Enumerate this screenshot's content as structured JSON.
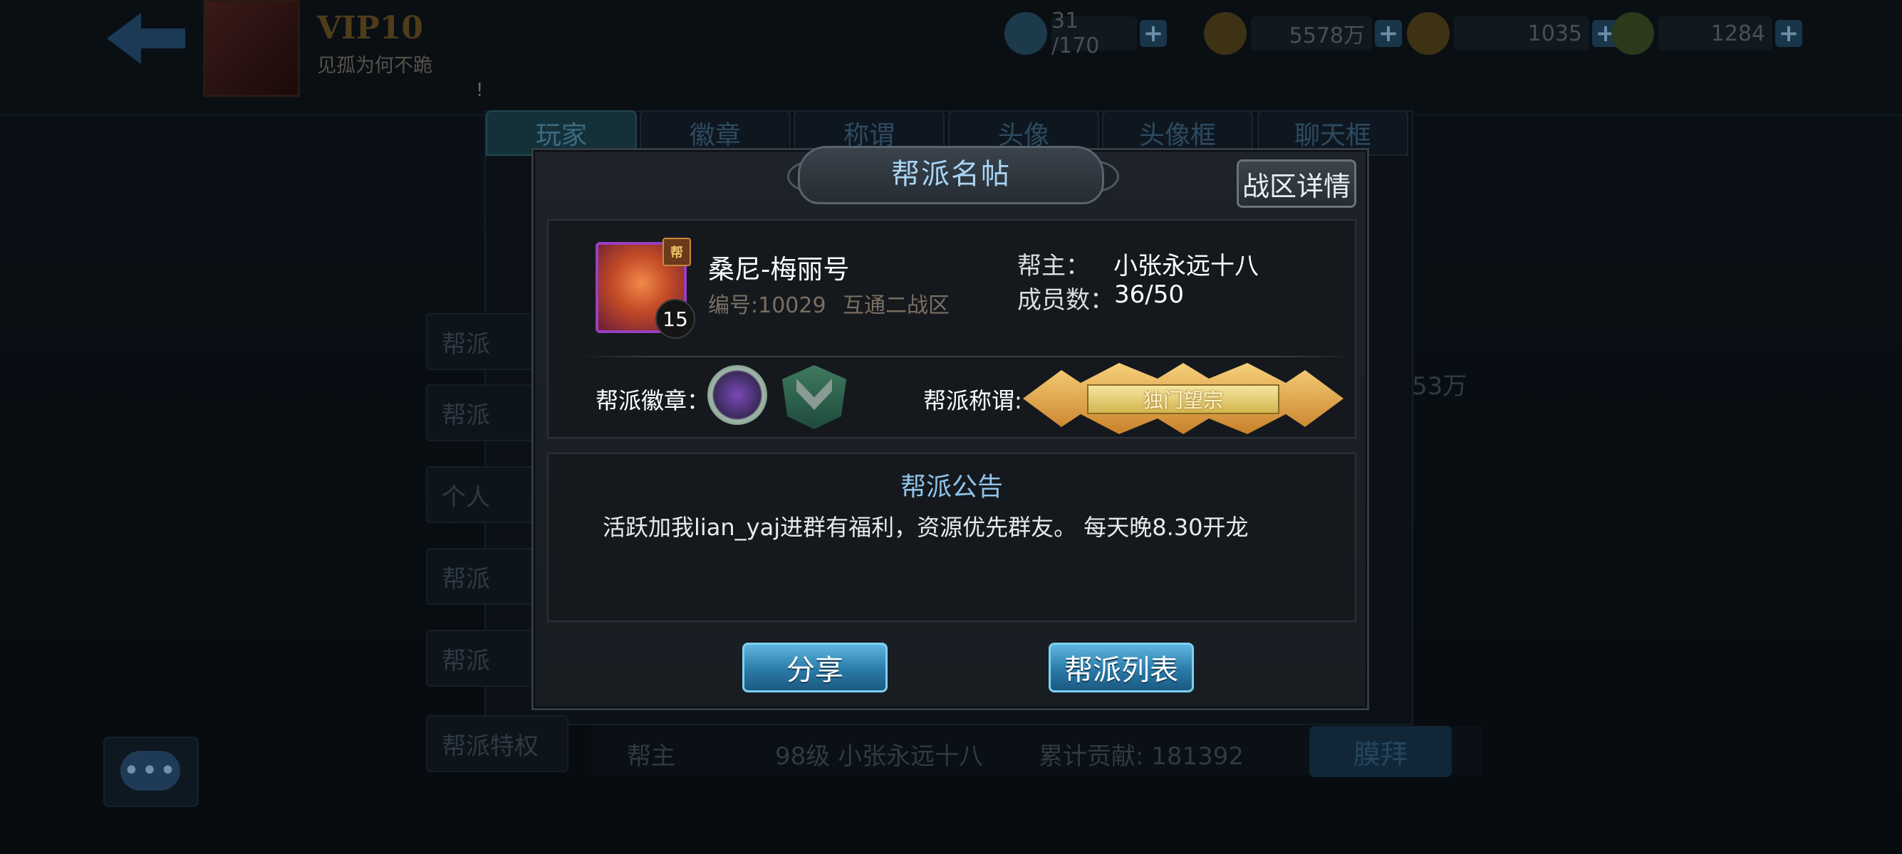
{
  "background": {
    "vip_label": "VIP10",
    "player_name": "见孤为何不跪",
    "mark": "!",
    "resources": [
      {
        "icon": "stamina-icon",
        "value": "31 /170"
      },
      {
        "icon": "gold-coin-icon",
        "value": "5578万"
      },
      {
        "icon": "ingot-icon",
        "value": "1035"
      },
      {
        "icon": "jade-icon",
        "value": "1284"
      }
    ],
    "tabs": [
      "玩家",
      "徽章",
      "称谓",
      "头像",
      "头像框",
      "聊天框"
    ],
    "side_items": [
      "帮派",
      "帮派",
      "个人",
      "帮派",
      "帮派",
      "帮派特权"
    ],
    "bottom": {
      "role": "帮主",
      "leader": "98级 小张永远十八",
      "contribution": "累计贡献: 181392",
      "worship_button": "膜拜"
    },
    "right_text": "53万"
  },
  "modal": {
    "title": "帮派名帖",
    "detail_button": "战区详情",
    "guild": {
      "name": "桑尼-梅丽号",
      "id": "编号:10029",
      "zone": "互通二战区",
      "level": "15",
      "icon_badge": "帮",
      "leader_label": "帮主：",
      "leader": "小张永远十八",
      "members_label": "成员数：",
      "members": "36/50"
    },
    "badge_label": "帮派徽章：",
    "title_label": "帮派称谓:",
    "title_value": "独门望宗",
    "notice_title": "帮派公告",
    "notice_text": "活跃加我lian_yaj进群有福利，资源优先群友。 每天晚8.30开龙",
    "buttons": {
      "share": "分享",
      "list": "帮派列表"
    }
  },
  "colors": {
    "accent_blue": "#8fc3ea",
    "button_blue": "#2a7aa8",
    "gold": "#d3b54e",
    "muted_text": "#7a6e62"
  }
}
